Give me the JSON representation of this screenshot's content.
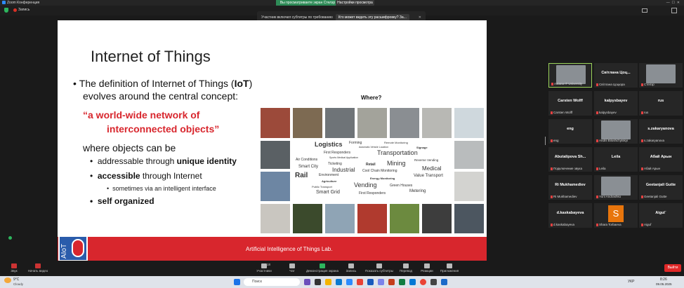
{
  "app_title": "Zoom Конференция",
  "sharing_banner": "Вы просматриваете экран Стелзр",
  "view_options_button": "Настройки просмотра",
  "recording_label": "Запись",
  "toast": {
    "text": "Участник включил субтитры по требованию",
    "link": "Кто может видеть эту расшифровку? За..."
  },
  "slide": {
    "title": "Internet of Things",
    "definition_line1": "The definition of Internet of Things (",
    "iot": "IoT",
    "definition_close": ")",
    "definition_line2": "evolves around the central concept:",
    "quote_line1": "“a world-wide network of",
    "quote_line2": "interconnected objects”",
    "where_objects": "where objects can be",
    "bullet1_pre": "addressable through ",
    "bullet1_bold": "unique identity",
    "bullet2_bold": "accessible",
    "bullet2_post": " through Internet",
    "sub_bullet": "sometimes via an intelligent interface",
    "bullet3": "self organized",
    "where_label": "Where?",
    "footer": "Artificial Intelligence of Things Lab.",
    "logo_text": "AIoT",
    "cloud_words": [
      "Logistics",
      "Forming",
      "Remote Monitoring",
      "Automatic Vehicle Location",
      "Signage",
      "First Responders",
      "Transportation",
      "Air Conditions",
      "Sports Medical Application",
      "Mining",
      "Reverse Vending",
      "Ticketing",
      "Retail",
      "Smart City",
      "Industrial",
      "Cool Chain Monitoring",
      "Medical",
      "Rail",
      "Environment",
      "Energy Monitoring",
      "Value Transport",
      "Agriculture",
      "Vending",
      "Green Houses",
      "Public Transport",
      "Smart Grid",
      "First Responders",
      "Metering"
    ]
  },
  "participants": [
    {
      "name": "",
      "sub": "Astana IT University",
      "video": true
    },
    {
      "name": "Світлана Цоц...",
      "sub": "Світлана Цоцюра",
      "video": false
    },
    {
      "name": "",
      "sub": "Стелзр",
      "video": true
    },
    {
      "name": "Carsten Wolff",
      "sub": "Carsten Wolff",
      "video": false
    },
    {
      "name": "kalpysbayev",
      "sub": "kalpysbayev",
      "video": false
    },
    {
      "name": "rus",
      "sub": "rus",
      "video": false
    },
    {
      "name": "eng",
      "sub": "eng",
      "video": false
    },
    {
      "name": "",
      "sub": "Andrii Biloshchytskyi",
      "video": true
    },
    {
      "name": "s.zakaryanova",
      "sub": "s.zakaryanova",
      "video": false
    },
    {
      "name": "Abutalipova Sh...",
      "sub": "Подключение звука",
      "video": false
    },
    {
      "name": "Leila",
      "sub": "Leila",
      "video": false
    },
    {
      "name": "Абай Арын",
      "sub": "Абай Арын",
      "video": false
    },
    {
      "name": "Ri Mukhamediev",
      "sub": "Ri Mukhamediev",
      "video": false
    },
    {
      "name": "",
      "sub": "Yurii Andrashko",
      "video": true
    },
    {
      "name": "Geetanjali Gutte",
      "sub": "Geetanjali Gutte",
      "video": false
    },
    {
      "name": "d.kaskabayeva",
      "sub": "d.kaskabayeva",
      "video": false
    },
    {
      "name": "S",
      "sub": "Shara Torbaeva",
      "video": false,
      "avatar_color": "#e8750c"
    },
    {
      "name": "Aigul`",
      "sub": "Aigul`",
      "video": false
    }
  ],
  "toolbar": {
    "audio": "Звук",
    "video": "Начать видео",
    "participants": "Участники",
    "participants_count": "18",
    "chat": "Чат",
    "share": "Демонстрация экрана",
    "record": "Запись",
    "captions": "Показать субтитры",
    "translate": "Перевод",
    "reactions": "Реакции",
    "apps": "Приложения",
    "end": "Выйти"
  },
  "taskbar": {
    "weather_temp": "9°C",
    "weather_desc": "Cloudy",
    "search_placeholder": "Поиск",
    "lang": "УКР",
    "time": "8:26",
    "date": "09.05.2025"
  },
  "colors": {
    "red": "#d8262d",
    "accent_green": "#2e8b57",
    "end": "#e02828"
  }
}
